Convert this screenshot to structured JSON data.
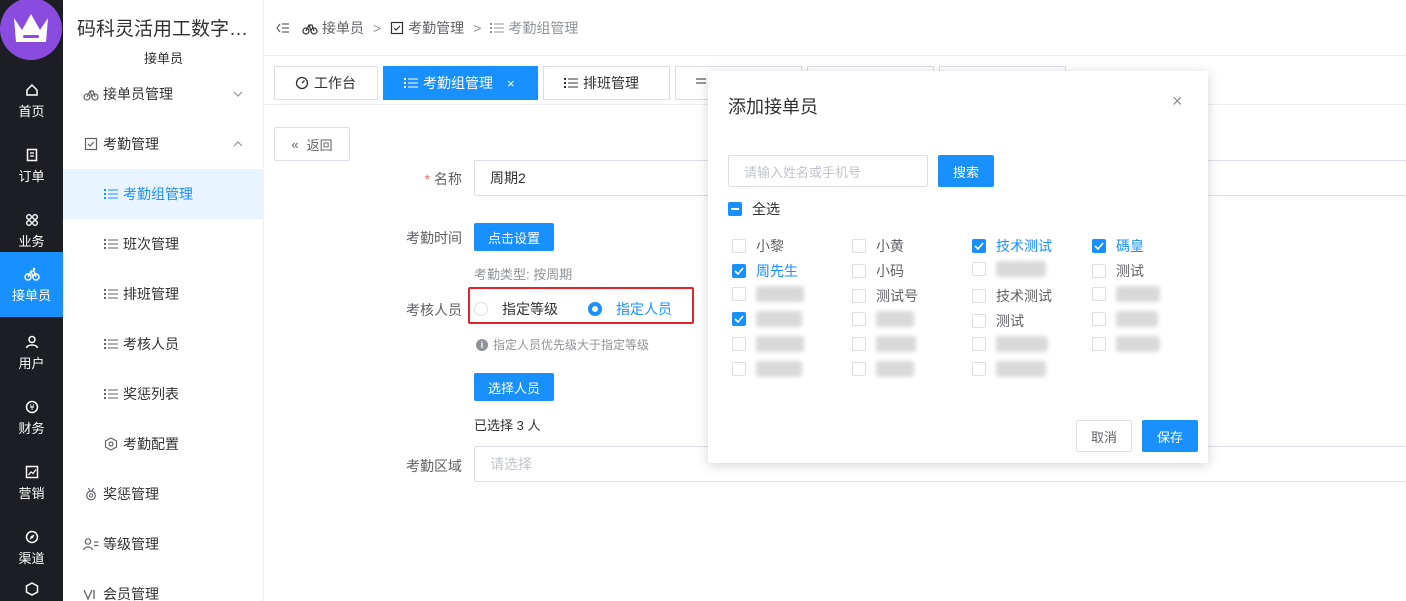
{
  "rail": {
    "items": [
      {
        "label": "首页",
        "icon": "home-icon"
      },
      {
        "label": "订单",
        "icon": "order-icon"
      },
      {
        "label": "业务",
        "icon": "apps-icon"
      },
      {
        "label": "接单员",
        "icon": "bicycle-icon",
        "active": true
      },
      {
        "label": "用户",
        "icon": "user-icon"
      },
      {
        "label": "财务",
        "icon": "money-icon"
      },
      {
        "label": "营销",
        "icon": "chart-icon"
      },
      {
        "label": "渠道",
        "icon": "compass-icon"
      }
    ]
  },
  "app": {
    "title": "码科灵活用工数字…",
    "section": "接单员"
  },
  "submenu": {
    "items": [
      {
        "label": "接单员管理",
        "level": 1,
        "expanded": false
      },
      {
        "label": "考勤管理",
        "level": 1,
        "expanded": true
      },
      {
        "label": "考勤组管理",
        "level": 2,
        "active": true
      },
      {
        "label": "班次管理",
        "level": 2
      },
      {
        "label": "排班管理",
        "level": 2
      },
      {
        "label": "考核人员",
        "level": 2
      },
      {
        "label": "奖惩列表",
        "level": 2
      },
      {
        "label": "考勤配置",
        "level": 2
      },
      {
        "label": "奖惩管理",
        "level": 1
      },
      {
        "label": "等级管理",
        "level": 1
      },
      {
        "label": "会员管理",
        "level": 1
      }
    ]
  },
  "breadcrumb": [
    "接单员",
    "考勤管理",
    "考勤组管理"
  ],
  "tabs": [
    {
      "label": "工作台",
      "active": false
    },
    {
      "label": "考勤组管理",
      "active": true,
      "close": "×"
    },
    {
      "label": "排班管理",
      "active": false
    }
  ],
  "form": {
    "back_label": "返回",
    "name_label": "名称",
    "name_value": "周期2",
    "time_label": "考勤时间",
    "time_button": "点击设置",
    "type_text": "考勤类型:  按周期",
    "assess_label": "考核人员",
    "radio_level": "指定等级",
    "radio_person": "指定人员",
    "hint": "指定人员优先级大于指定等级",
    "select_button": "选择人员",
    "selected_text": "已选择 3 人",
    "area_label": "考勤区域",
    "area_placeholder": "请选择"
  },
  "dialog": {
    "title": "添加接单员",
    "close": "×",
    "search_placeholder": "请输入姓名或手机号",
    "search_button": "搜索",
    "select_all": "全选",
    "checkboxes": [
      {
        "label": "小黎",
        "checked": false
      },
      {
        "label": "小黄",
        "checked": false
      },
      {
        "label": "技术测试",
        "checked": true
      },
      {
        "label": "碼皇",
        "checked": true
      },
      {
        "label": "周先生",
        "checked": true
      },
      {
        "label": "小码",
        "checked": false
      },
      {
        "label": "",
        "checked": false,
        "blurred": true
      },
      {
        "label": "测试",
        "checked": false
      },
      {
        "label": "",
        "checked": false,
        "blurred": true
      },
      {
        "label": "测试号",
        "checked": false
      },
      {
        "label": "技术测试",
        "checked": false
      },
      {
        "label": "",
        "checked": false,
        "blurred": true
      },
      {
        "label": "",
        "checked": true,
        "blurred": true
      },
      {
        "label": "",
        "checked": false,
        "blurred": true
      },
      {
        "label": "测试",
        "checked": false
      },
      {
        "label": "",
        "checked": false,
        "blurred": true
      },
      {
        "label": "",
        "checked": false,
        "blurred": true
      },
      {
        "label": "",
        "checked": false,
        "blurred": true
      },
      {
        "label": "",
        "checked": false,
        "blurred": true
      },
      {
        "label": "",
        "checked": false,
        "blurred": true
      },
      {
        "label": "",
        "checked": false,
        "blurred": true
      },
      {
        "label": "",
        "checked": false,
        "blurred": true
      },
      {
        "label": "",
        "checked": false,
        "blurred": true
      }
    ],
    "cancel": "取消",
    "save": "保存"
  },
  "colors": {
    "primary": "#1890ff",
    "rail_bg": "#1d1e23",
    "highlight": "#e0252b",
    "logo": "#8a4cde"
  }
}
